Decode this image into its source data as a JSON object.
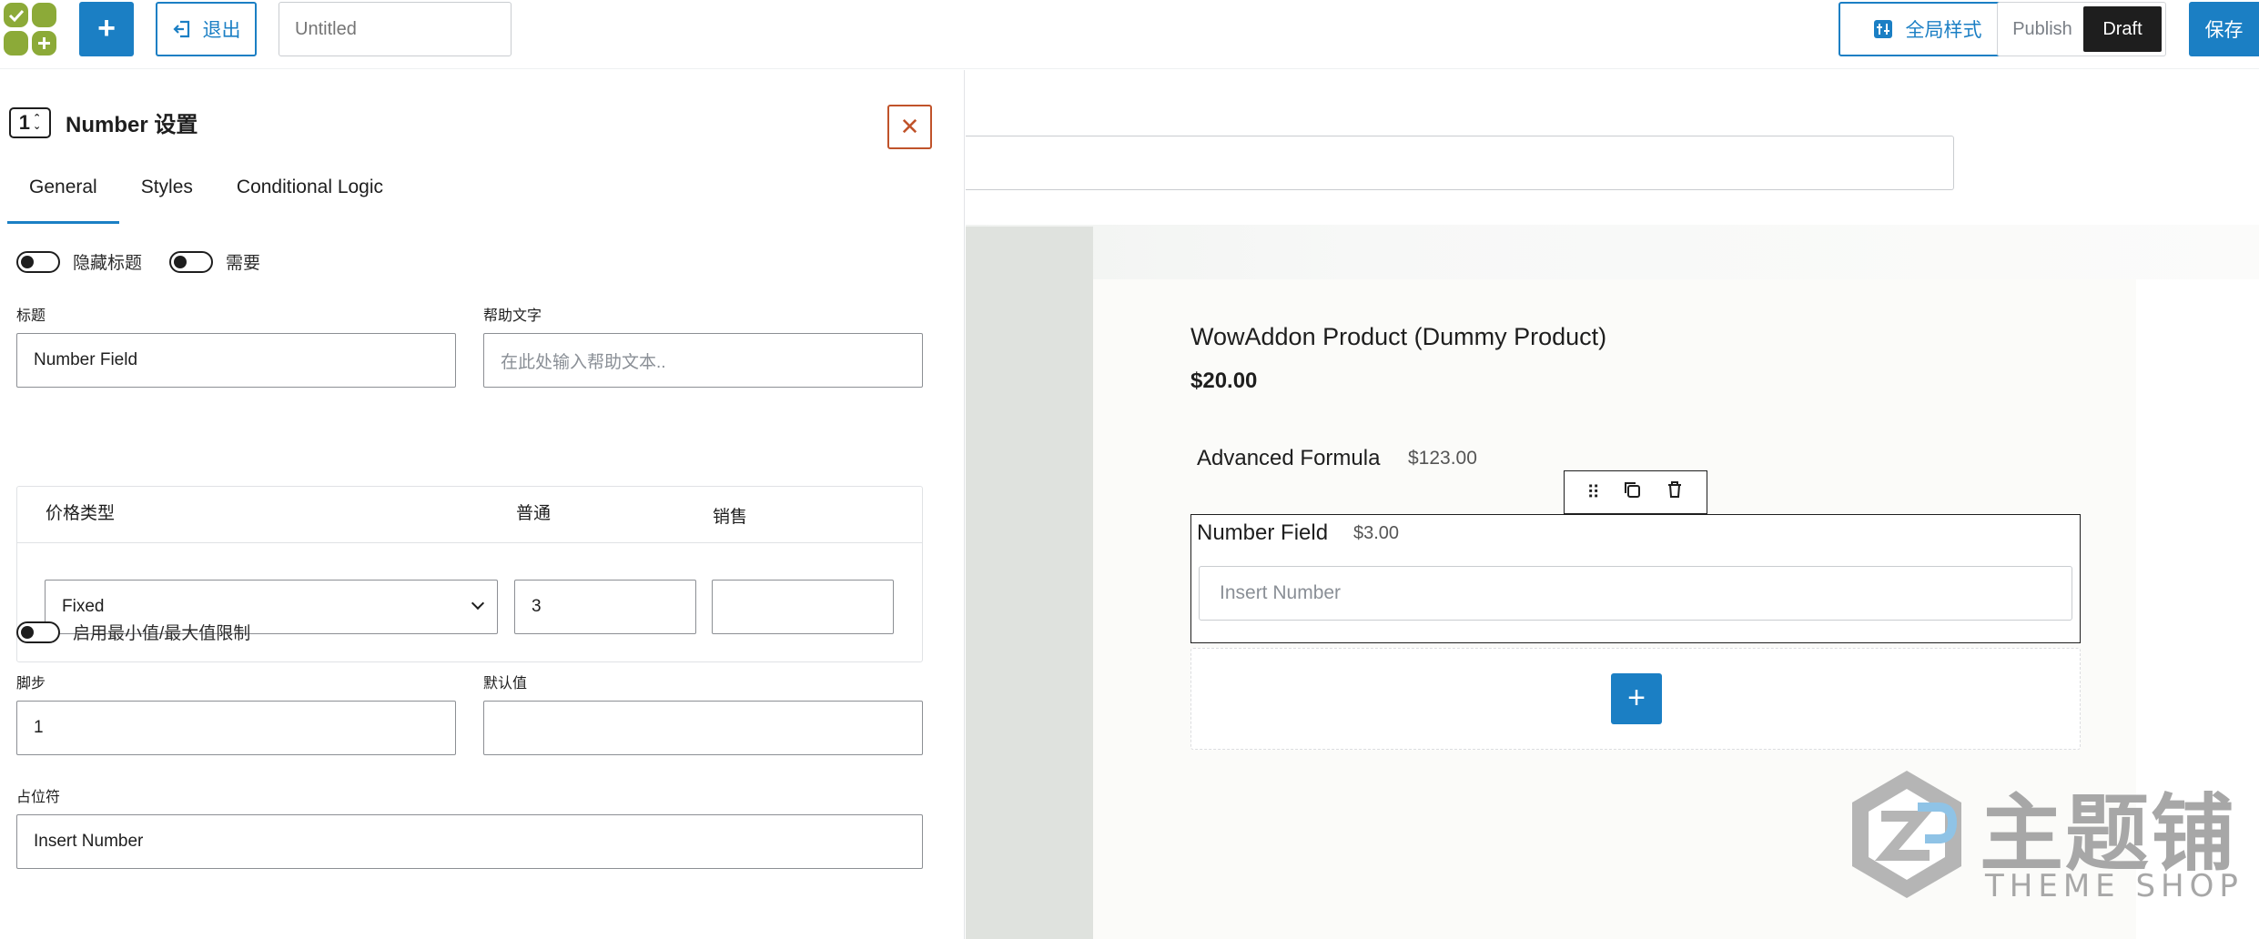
{
  "topbar": {
    "exit_label": "退出",
    "title_placeholder": "Untitled",
    "global_style_label": "全局样式",
    "publish_label": "Publish",
    "draft_label": "Draft",
    "save_label": "保存"
  },
  "panel": {
    "title": "Number 设置",
    "icon_digit": "1",
    "tabs": [
      {
        "label": "General"
      },
      {
        "label": "Styles"
      },
      {
        "label": "Conditional Logic"
      }
    ],
    "toggles": {
      "hide_title": "隐藏标题",
      "required": "需要",
      "min_max": "启用最小值/最大值限制"
    },
    "fields": {
      "title_label": "标题",
      "title_value": "Number Field",
      "help_label": "帮助文字",
      "help_placeholder": "在此处输入帮助文本..",
      "price_type_label": "价格类型",
      "regular_label": "普通",
      "sale_label": "销售",
      "price_type_value": "Fixed",
      "regular_value": "3",
      "sale_value": "",
      "step_label": "脚步",
      "step_value": "1",
      "default_label": "默认值",
      "default_value": "",
      "placeholder_label": "占位符",
      "placeholder_value": "Insert Number"
    }
  },
  "preview": {
    "product_title": "WowAddon Product (Dummy Product)",
    "product_price": "$20.00",
    "advanced_formula_label": "Advanced Formula",
    "advanced_formula_price": "$123.00",
    "number_field_label": "Number Field",
    "number_field_price": "$3.00",
    "number_field_placeholder": "Insert Number"
  },
  "watermark": {
    "zh": "主题铺",
    "en": "THEME SHOP"
  },
  "colors": {
    "accent": "#1b7fc4",
    "close": "#c0532a",
    "logo_green": "#8caa38"
  }
}
